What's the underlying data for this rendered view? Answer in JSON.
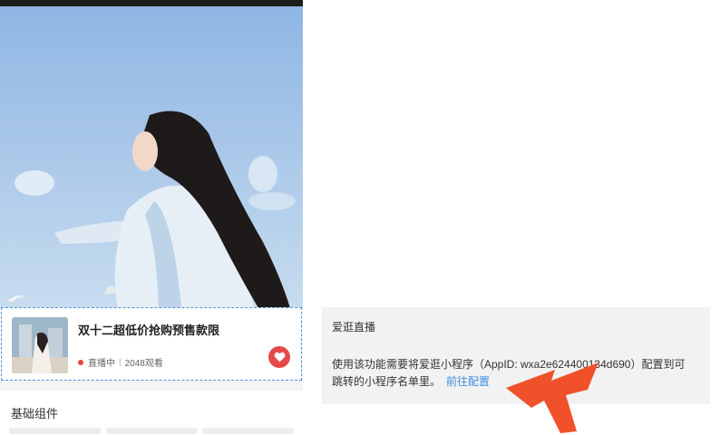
{
  "live_card": {
    "title": "双十二超低价抢购预售款限",
    "status": "直播中",
    "viewers": "2048观看",
    "separator": "|"
  },
  "section": {
    "title": "基础组件"
  },
  "info_panel": {
    "title": "爱逛直播",
    "line1": "使用该功能需要将爱逛小程序（AppID: wxa2e624400134d690）配置到可",
    "line2": "跳转的小程序名单里。",
    "link": "前往配置"
  },
  "colors": {
    "live_dot": "#e8453c",
    "heart_button": "#e54848",
    "link": "#3d8ee0",
    "arrow": "#f0512b",
    "selection_border": "#4a90e2"
  },
  "icons": {
    "heart": "heart-icon",
    "arrow": "arrow-annotation"
  }
}
